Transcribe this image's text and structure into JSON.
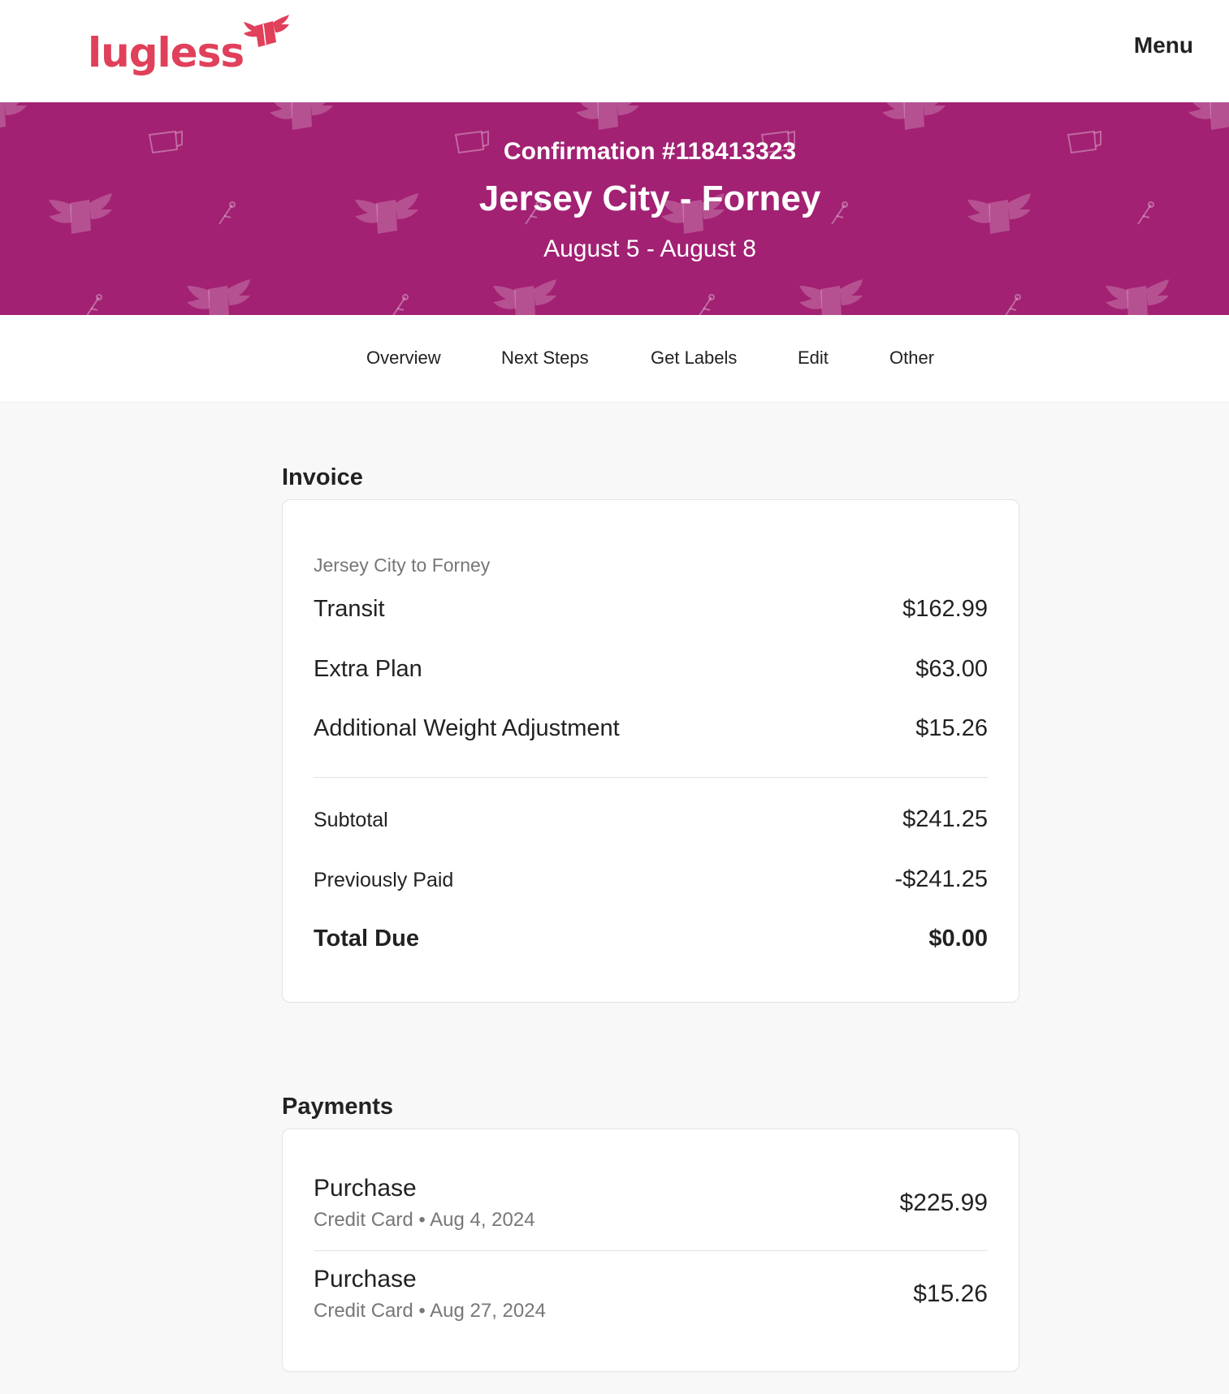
{
  "header": {
    "logo_text": "lugless",
    "menu_label": "Menu"
  },
  "hero": {
    "confirmation": "Confirmation #118413323",
    "title": "Jersey City - Forney",
    "dates": "August 5 - August 8",
    "background_color": "#a22173"
  },
  "tabs": [
    {
      "label": "Overview"
    },
    {
      "label": "Next Steps"
    },
    {
      "label": "Get Labels"
    },
    {
      "label": "Edit"
    },
    {
      "label": "Other"
    }
  ],
  "invoice": {
    "section_title": "Invoice",
    "route": "Jersey City to Forney",
    "line_items": [
      {
        "label": "Transit",
        "amount": "$162.99"
      },
      {
        "label": "Extra Plan",
        "amount": "$63.00"
      },
      {
        "label": "Additional Weight Adjustment",
        "amount": "$15.26"
      }
    ],
    "subtotal": {
      "label": "Subtotal",
      "amount": "$241.25"
    },
    "previously_paid": {
      "label": "Previously Paid",
      "amount": "-$241.25"
    },
    "total_due": {
      "label": "Total Due",
      "amount": "$0.00"
    }
  },
  "payments": {
    "section_title": "Payments",
    "items": [
      {
        "title": "Purchase",
        "meta": "Credit Card • Aug 4, 2024",
        "amount": "$225.99"
      },
      {
        "title": "Purchase",
        "meta": "Credit Card • Aug 27, 2024",
        "amount": "$15.26"
      }
    ]
  },
  "colors": {
    "brand": "#e0405a",
    "hero": "#a22173"
  }
}
